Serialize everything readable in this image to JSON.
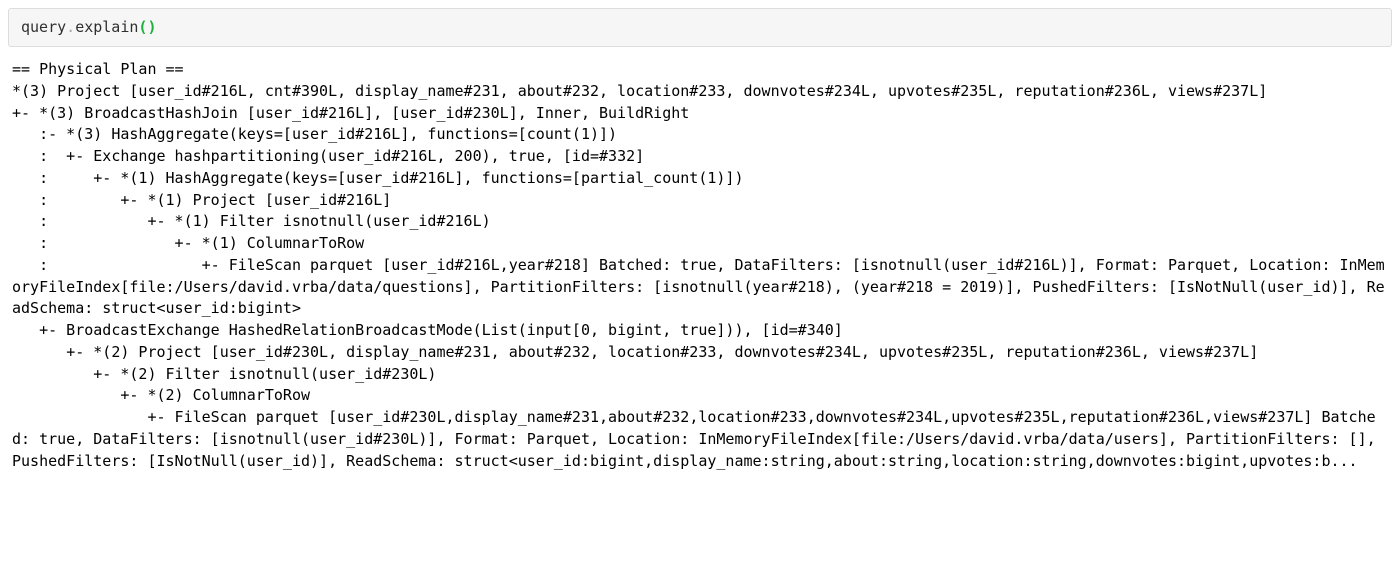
{
  "code": {
    "object": "query",
    "dot": ".",
    "method": "explain",
    "lparen": "(",
    "rparen": ")"
  },
  "output": "== Physical Plan ==\n*(3) Project [user_id#216L, cnt#390L, display_name#231, about#232, location#233, downvotes#234L, upvotes#235L, reputation#236L, views#237L]\n+- *(3) BroadcastHashJoin [user_id#216L], [user_id#230L], Inner, BuildRight\n   :- *(3) HashAggregate(keys=[user_id#216L], functions=[count(1)])\n   :  +- Exchange hashpartitioning(user_id#216L, 200), true, [id=#332]\n   :     +- *(1) HashAggregate(keys=[user_id#216L], functions=[partial_count(1)])\n   :        +- *(1) Project [user_id#216L]\n   :           +- *(1) Filter isnotnull(user_id#216L)\n   :              +- *(1) ColumnarToRow\n   :                 +- FileScan parquet [user_id#216L,year#218] Batched: true, DataFilters: [isnotnull(user_id#216L)], Format: Parquet, Location: InMemoryFileIndex[file:/Users/david.vrba/data/questions], PartitionFilters: [isnotnull(year#218), (year#218 = 2019)], PushedFilters: [IsNotNull(user_id)], ReadSchema: struct<user_id:bigint>\n   +- BroadcastExchange HashedRelationBroadcastMode(List(input[0, bigint, true])), [id=#340]\n      +- *(2) Project [user_id#230L, display_name#231, about#232, location#233, downvotes#234L, upvotes#235L, reputation#236L, views#237L]\n         +- *(2) Filter isnotnull(user_id#230L)\n            +- *(2) ColumnarToRow\n               +- FileScan parquet [user_id#230L,display_name#231,about#232,location#233,downvotes#234L,upvotes#235L,reputation#236L,views#237L] Batched: true, DataFilters: [isnotnull(user_id#230L)], Format: Parquet, Location: InMemoryFileIndex[file:/Users/david.vrba/data/users], PartitionFilters: [], PushedFilters: [IsNotNull(user_id)], ReadSchema: struct<user_id:bigint,display_name:string,about:string,location:string,downvotes:bigint,upvotes:b..."
}
